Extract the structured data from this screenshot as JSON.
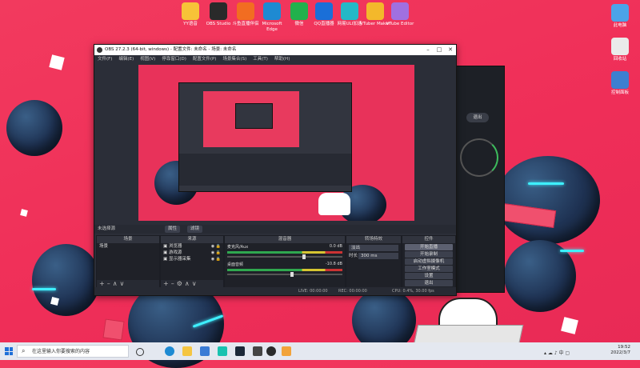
{
  "desktop_icons": [
    {
      "label": "YY语音",
      "color": "#f7c338"
    },
    {
      "label": "OBS Studio",
      "color": "#2a2a2a"
    },
    {
      "label": "斗鱼直播伴侣",
      "color": "#f26d21"
    },
    {
      "label": "Microsoft Edge",
      "color": "#1e8ad2"
    },
    {
      "label": "微信",
      "color": "#22b14c"
    },
    {
      "label": "QQ直播器",
      "color": "#1a6fd8"
    },
    {
      "label": "网易ULI加速",
      "color": "#24b8c7"
    },
    {
      "label": "VTuber Maker",
      "color": "#f3b82b"
    },
    {
      "label": "VTube Editor",
      "color": "#a070e0"
    }
  ],
  "right_desktop_icons": [
    {
      "label": "此电脑",
      "color": "#4ba3e8"
    },
    {
      "label": "回收站",
      "color": "#eaeaea"
    },
    {
      "label": "控制面板",
      "color": "#3d7fd0"
    }
  ],
  "obs": {
    "title": "OBS 27.2.3 (64-bit, windows) - 配置文件: 未命名 - 场景: 未命名",
    "menu": [
      "文件(F)",
      "编辑(E)",
      "视图(V)",
      "停靠窗口(D)",
      "配置文件(P)",
      "场景集合(S)",
      "工具(T)",
      "帮助(H)"
    ],
    "scene_bar": {
      "label": "未选择源",
      "props": "属性",
      "filters": "滤镜"
    },
    "docks": {
      "scenes": {
        "title": "场景",
        "items": [
          "场景"
        ]
      },
      "sources": {
        "title": "来源",
        "items": [
          "浏览器",
          "游戏源",
          "显示器采集"
        ]
      },
      "mixer": {
        "title": "混音器",
        "channels": [
          {
            "name": "麦克风/Aux",
            "db": "0.0 dB",
            "fill": 0.65
          },
          {
            "name": "桌面音频",
            "db": "-10.8 dB",
            "fill": 0.55
          }
        ]
      },
      "transitions": {
        "title": "转场特效",
        "type": "淡出",
        "duration_label": "时长",
        "duration": "300 ms"
      },
      "controls": {
        "title": "控件",
        "buttons": [
          "开始直播",
          "开始录制",
          "启动虚拟摄像机",
          "工作室模式",
          "设置",
          "退出"
        ]
      }
    },
    "status": {
      "live": "LIVE: 00:00:00",
      "rec": "REC: 00:00:00",
      "cpu": "CPU: 0.4%, 30.00 fps"
    }
  },
  "side_app": {
    "button": "退出"
  },
  "taskbar": {
    "search_placeholder": "在这里输入你要搜索的内容",
    "time": "19:52",
    "date": "2022/3/7"
  }
}
